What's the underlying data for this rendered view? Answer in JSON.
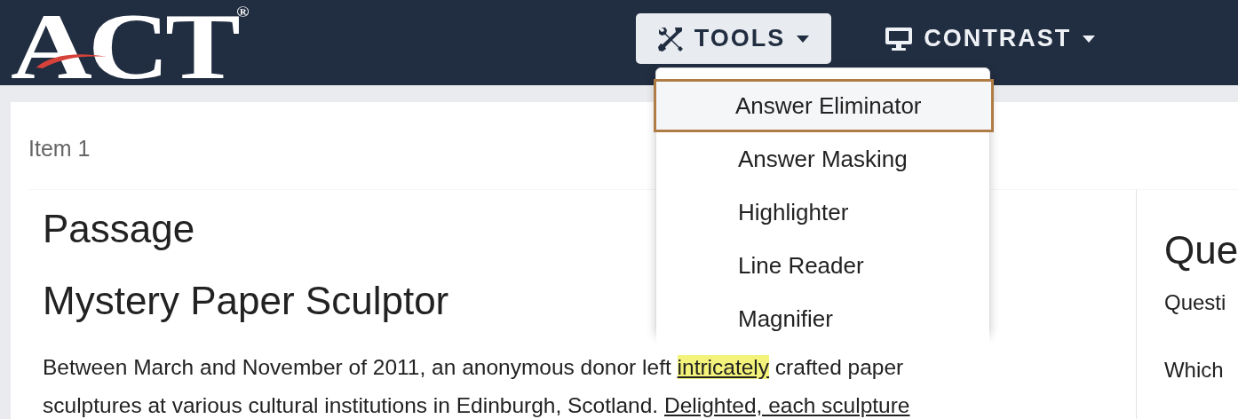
{
  "header": {
    "logo": {
      "text": "ACT",
      "mark": "®"
    },
    "menus": [
      {
        "label": "TOOLS",
        "expanded": true
      },
      {
        "label": "CONTRAST",
        "expanded": false
      }
    ]
  },
  "tools_menu": {
    "items": [
      {
        "label": "Answer Eliminator",
        "selected": true
      },
      {
        "label": "Answer Masking",
        "selected": false
      },
      {
        "label": "Highlighter",
        "selected": false
      },
      {
        "label": "Line Reader",
        "selected": false
      },
      {
        "label": "Magnifier",
        "selected": false
      }
    ]
  },
  "item_label": "Item 1",
  "passage": {
    "heading": "Passage",
    "title": "Mystery Paper Sculptor",
    "lines": [
      [
        {
          "text": "Between March and November of 2011, an anonymous donor left ",
          "underlined": false,
          "highlighted": false
        },
        {
          "text": "intricately",
          "underlined": true,
          "highlighted": true
        },
        {
          "text": " crafted paper",
          "underlined": false,
          "highlighted": false
        }
      ],
      [
        {
          "text": "sculptures at various cultural institutions in Edinburgh, Scotland. ",
          "underlined": false,
          "highlighted": false
        },
        {
          "text": "Delighted, each sculpture",
          "underlined": true,
          "highlighted": false
        }
      ]
    ]
  },
  "question": {
    "heading": "Que",
    "number": "Questi",
    "prompt": "Which"
  }
}
